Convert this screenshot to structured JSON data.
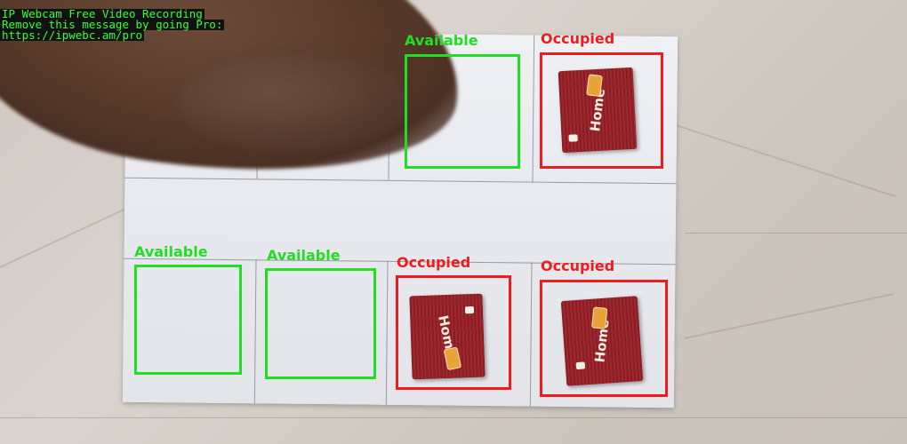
{
  "overlay": {
    "lines": [
      "IP Webcam Free Video Recording",
      "Remove this message by going Pro:",
      "https://ipwebc.am/pro"
    ]
  },
  "slots": [
    {
      "id": "top-3",
      "status_label": "Available",
      "state": "free"
    },
    {
      "id": "top-4",
      "status_label": "Occupied",
      "state": "busy"
    },
    {
      "id": "bottom-1",
      "status_label": "Available",
      "state": "free"
    },
    {
      "id": "bottom-2",
      "status_label": "Available",
      "state": "free"
    },
    {
      "id": "bottom-3",
      "status_label": "Occupied",
      "state": "busy"
    },
    {
      "id": "bottom-4",
      "status_label": "Occupied",
      "state": "busy"
    }
  ],
  "package": {
    "brand": "Home"
  },
  "colors": {
    "available": "#22dd22",
    "occupied": "#ee1c1c",
    "package": "#8a1c22"
  }
}
